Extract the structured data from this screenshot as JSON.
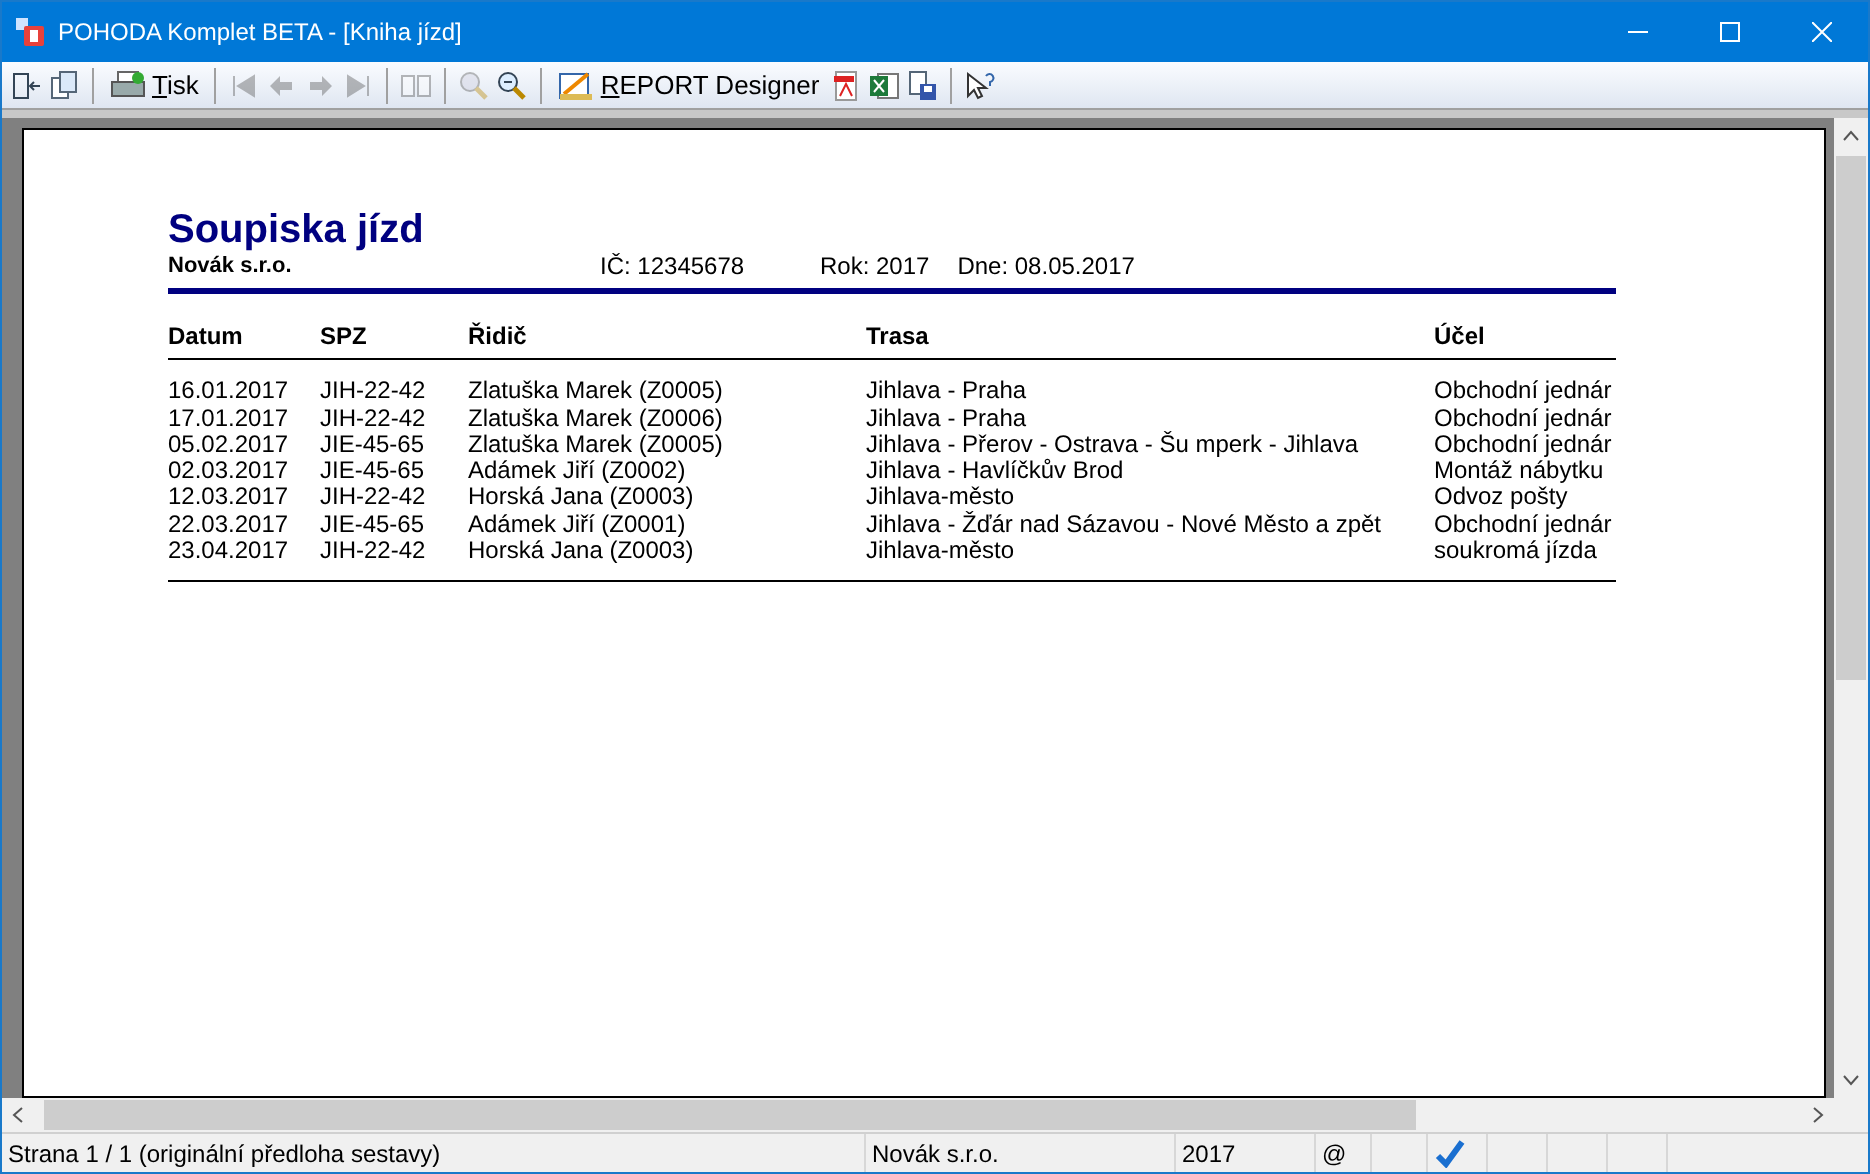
{
  "window": {
    "title": "POHODA Komplet BETA - [Kniha jízd]"
  },
  "toolbar": {
    "print_label": "Tisk",
    "designer_label": "REPORT Designer",
    "navigation_disabled": true,
    "zoom_in_disabled": true
  },
  "report": {
    "title": "Soupiska jízd",
    "company": "Novák s.r.o.",
    "ic": "IČ: 12345678",
    "year": "Rok: 2017",
    "date": "Dne: 08.05.2017",
    "columns": [
      "Datum",
      "SPZ",
      "Řidič",
      "Trasa",
      "Účel"
    ],
    "rows": [
      [
        "16.01.2017",
        "JIH-22-42",
        "Zlatuška Marek (Z0005)",
        "Jihlava - Praha",
        "Obchodní jednár"
      ],
      [
        "17.01.2017",
        "JIH-22-42",
        "Zlatuška Marek (Z0006)",
        "Jihlava - Praha",
        "Obchodní jednár"
      ],
      [
        "05.02.2017",
        "JIE-45-65",
        "Zlatuška Marek (Z0005)",
        "Jihlava - Přerov - Ostrava - Šu mperk - Jihlava",
        "Obchodní jednár"
      ],
      [
        "02.03.2017",
        "JIE-45-65",
        "Adámek Jiří (Z0002)",
        "Jihlava - Havlíčkův Brod",
        "Montáž nábytku"
      ],
      [
        "12.03.2017",
        "JIH-22-42",
        "Horská Jana (Z0003)",
        "Jihlava-město",
        "Odvoz pošty"
      ],
      [
        "22.03.2017",
        "JIE-45-65",
        "Adámek Jiří (Z0001)",
        "Jihlava - Žďár nad Sázavou - Nové Město a zpět",
        "Obchodní jednár"
      ],
      [
        "23.04.2017",
        "JIH-22-42",
        "Horská Jana (Z0003)",
        "Jihlava-město",
        "soukromá jízda"
      ]
    ]
  },
  "status_bar": {
    "page": "Strana 1 / 1  (originální předloha sestavy)",
    "company": "Novák s.r.o.",
    "year": "2017",
    "mail": "@"
  }
}
